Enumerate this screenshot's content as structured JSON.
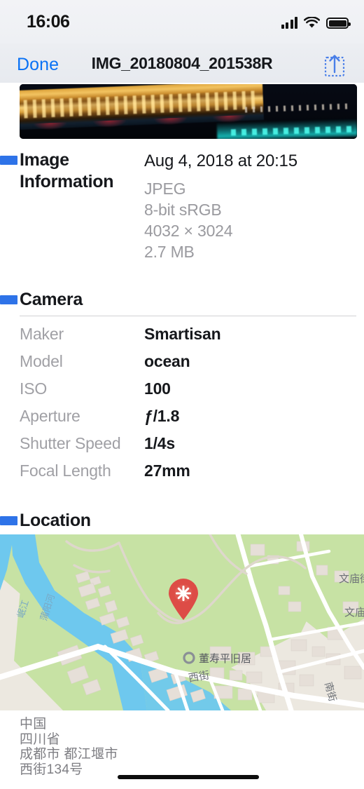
{
  "status_bar": {
    "time": "16:06",
    "signal_icon": "cellular-bars-icon",
    "wifi_icon": "wifi-icon",
    "battery_icon": "battery-full-icon"
  },
  "nav_bar": {
    "done_label": "Done",
    "title": "IMG_20180804_201538R",
    "share_icon": "share-upload-icon"
  },
  "photo": {
    "alt": "night photo of illuminated covered bridge over water"
  },
  "sections": {
    "image_information": {
      "title_line1": "Image",
      "title_line2": "Information",
      "date": "Aug 4, 2018 at 20:15",
      "format": "JPEG",
      "color": "8-bit sRGB",
      "dimensions": "4032 × 3024",
      "filesize": "2.7 MB"
    },
    "camera": {
      "title": "Camera",
      "rows": [
        {
          "label": "Maker",
          "value": "Smartisan"
        },
        {
          "label": "Model",
          "value": "ocean"
        },
        {
          "label": "ISO",
          "value": "100"
        },
        {
          "label": "Aperture",
          "value": "ƒ/1.8"
        },
        {
          "label": "Shutter Speed",
          "value": "1/4s"
        },
        {
          "label": "Focal Length",
          "value": "27mm"
        }
      ]
    },
    "location": {
      "title": "Location",
      "pin_icon": "map-pin-icon",
      "map_labels": {
        "river_left": "岷江",
        "river_right": "蒲阳河",
        "poi": "董寿平旧居",
        "street_west": "西街",
        "street_south": "南街",
        "street_wenmiao_1": "文庙街",
        "street_wenmiao_2": "文庙街"
      },
      "address_lines": [
        "中国",
        "四川省",
        "成都市 都江堰市",
        "西街134号"
      ]
    }
  },
  "colors": {
    "accent_blue": "#2e73e8",
    "link_blue": "#0a72f5",
    "muted_text": "#9a9a9f",
    "pin_red": "#e04848",
    "map_park_green": "#c7e2a4",
    "map_water_blue": "#6ec8ee"
  }
}
